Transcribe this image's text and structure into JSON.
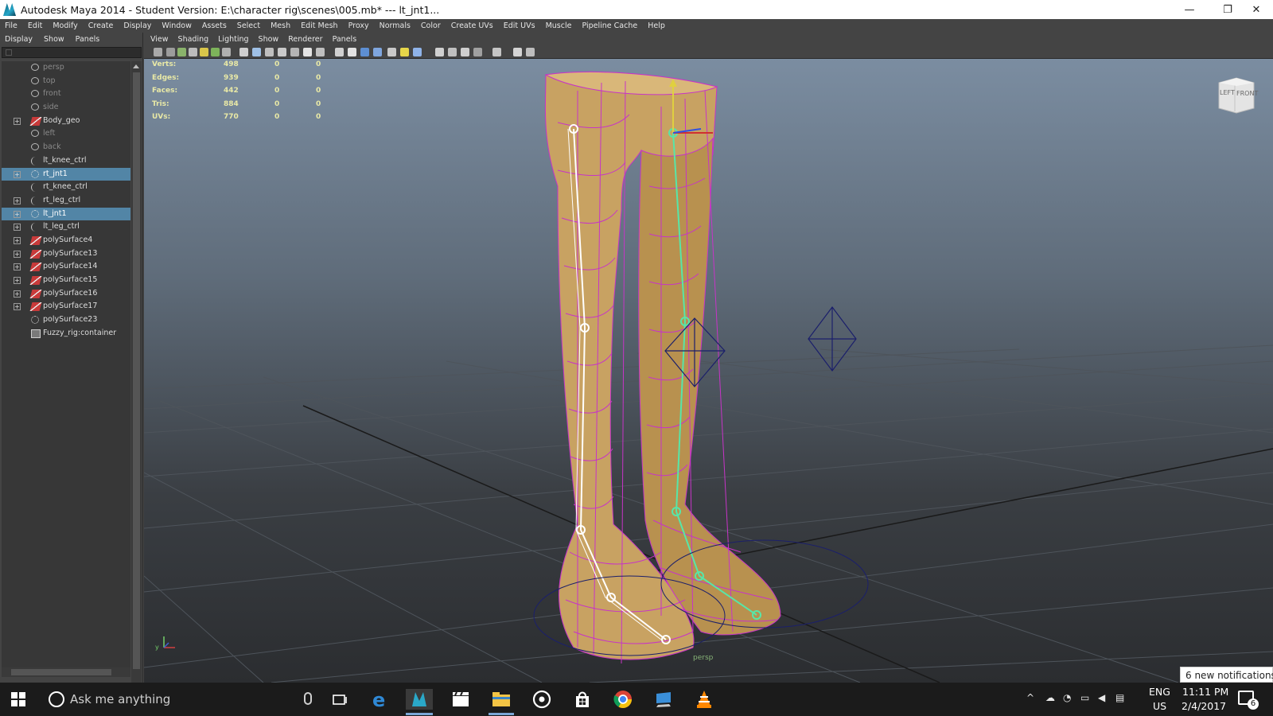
{
  "window": {
    "title": "Autodesk Maya 2014 - Student Version: E:\\character rig\\scenes\\005.mb*   ---   lt_jnt1...",
    "minimize_glyph": "—",
    "restore_glyph": "❐",
    "close_glyph": "✕"
  },
  "menubar": {
    "items": [
      "File",
      "Edit",
      "Modify",
      "Create",
      "Display",
      "Window",
      "Assets",
      "Select",
      "Mesh",
      "Edit Mesh",
      "Proxy",
      "Normals",
      "Color",
      "Create UVs",
      "Edit UVs",
      "Muscle",
      "Pipeline Cache",
      "Help"
    ]
  },
  "outliner": {
    "menu": [
      "Display",
      "Show",
      "Panels"
    ],
    "items": [
      {
        "label": "persp",
        "icon": "camera-icon",
        "dim": true,
        "expander": false,
        "selected": false
      },
      {
        "label": "top",
        "icon": "camera-icon",
        "dim": true,
        "expander": false,
        "selected": false
      },
      {
        "label": "front",
        "icon": "camera-icon",
        "dim": true,
        "expander": false,
        "selected": false
      },
      {
        "label": "side",
        "icon": "camera-icon",
        "dim": true,
        "expander": false,
        "selected": false
      },
      {
        "label": "Body_geo",
        "icon": "mesh-icon",
        "dim": false,
        "expander": true,
        "selected": false
      },
      {
        "label": "left",
        "icon": "camera-icon",
        "dim": true,
        "expander": false,
        "selected": false
      },
      {
        "label": "back",
        "icon": "camera-icon",
        "dim": true,
        "expander": false,
        "selected": false
      },
      {
        "label": "lt_knee_ctrl",
        "icon": "curve-icon",
        "dim": false,
        "expander": false,
        "selected": false
      },
      {
        "label": "rt_jnt1",
        "icon": "joint-icon",
        "dim": false,
        "expander": true,
        "selected": true
      },
      {
        "label": "rt_knee_ctrl",
        "icon": "curve-icon",
        "dim": false,
        "expander": false,
        "selected": false
      },
      {
        "label": "rt_leg_ctrl",
        "icon": "curve-icon",
        "dim": false,
        "expander": true,
        "selected": false
      },
      {
        "label": "lt_jnt1",
        "icon": "joint-icon",
        "dim": false,
        "expander": true,
        "selected": true
      },
      {
        "label": "lt_leg_ctrl",
        "icon": "curve-icon",
        "dim": false,
        "expander": true,
        "selected": false
      },
      {
        "label": "polySurface4",
        "icon": "mesh-icon",
        "dim": false,
        "expander": true,
        "selected": false
      },
      {
        "label": "polySurface13",
        "icon": "mesh-icon",
        "dim": false,
        "expander": true,
        "selected": false
      },
      {
        "label": "polySurface14",
        "icon": "mesh-icon",
        "dim": false,
        "expander": true,
        "selected": false
      },
      {
        "label": "polySurface15",
        "icon": "mesh-icon",
        "dim": false,
        "expander": true,
        "selected": false
      },
      {
        "label": "polySurface16",
        "icon": "mesh-icon",
        "dim": false,
        "expander": true,
        "selected": false
      },
      {
        "label": "polySurface17",
        "icon": "mesh-icon",
        "dim": false,
        "expander": true,
        "selected": false
      },
      {
        "label": "polySurface23",
        "icon": "joint-icon",
        "dim": false,
        "expander": false,
        "selected": false
      },
      {
        "label": "Fuzzy_rig:container",
        "icon": "container-icon",
        "dim": false,
        "expander": false,
        "selected": false
      }
    ]
  },
  "viewport": {
    "menu": [
      "View",
      "Shading",
      "Lighting",
      "Show",
      "Renderer",
      "Panels"
    ],
    "hud": [
      {
        "label": "Verts:",
        "values": [
          "498",
          "0",
          "0"
        ]
      },
      {
        "label": "Edges:",
        "values": [
          "939",
          "0",
          "0"
        ]
      },
      {
        "label": "Faces:",
        "values": [
          "442",
          "0",
          "0"
        ]
      },
      {
        "label": "Tris:",
        "values": [
          "884",
          "0",
          "0"
        ]
      },
      {
        "label": "UVs:",
        "values": [
          "770",
          "0",
          "0"
        ]
      }
    ],
    "camera_label": "persp",
    "viewcube": {
      "front": "FRONT",
      "left": "LEFT"
    },
    "axis_label": "y"
  },
  "notification": "6 new notifications",
  "taskbar": {
    "search_placeholder": "Ask me anything",
    "lang_top": "ENG",
    "lang_bottom": "US",
    "time": "11:11 PM",
    "date": "2/4/2017",
    "notif_count": "6"
  },
  "colors": {
    "selection": "#5285a6",
    "mesh": "#c8a262",
    "wireframe": "#c734c7",
    "joint_selected": "#57e6a8",
    "grid": "#555a60"
  }
}
